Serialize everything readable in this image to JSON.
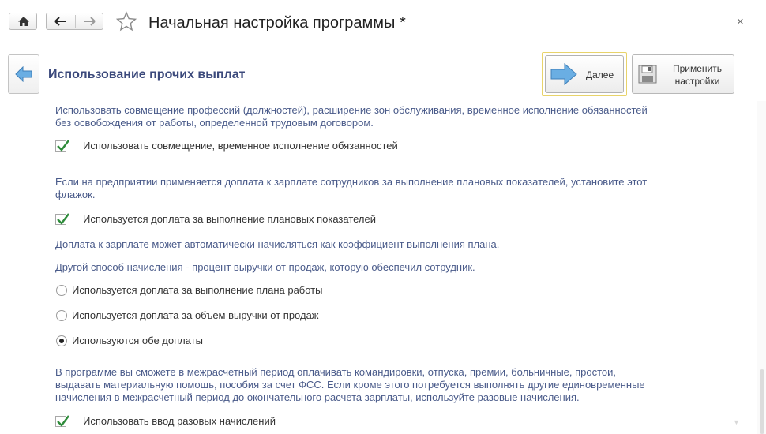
{
  "window": {
    "title": "Начальная настройка программы *",
    "close_glyph": "×"
  },
  "header": {
    "title": "Использование прочих выплат",
    "next_label": "Далее",
    "apply_label_line1": "Применить",
    "apply_label_line2": "настройки"
  },
  "sections": {
    "combination_desc_1": "Использовать совмещение профессий (должностей), расширение зон обслуживания, временное исполнение обязанностей",
    "combination_desc_2": "без освобождения от работы, определенной трудовым договором.",
    "combination_checkbox": "Использовать совмещение, временное исполнение обязанностей",
    "plan_desc_1": "Если на предприятии применяется доплата к зарплате сотрудников за выполнение плановых показателей, установите этот",
    "plan_desc_2": "флажок.",
    "plan_checkbox": "Используется доплата за выполнение плановых показателей",
    "auto_desc": "Доплата к зарплате может автоматически начисляться как коэффициент выполнения плана.",
    "other_desc": "Другой способ начисления - процент выручки от продаж, которую обеспечил сотрудник.",
    "radio_options": [
      "Используется доплата за выполнение плана работы",
      "Используется доплата за объем выручки от продаж",
      "Используются обе доплаты"
    ],
    "radio_selected": 2,
    "onetime_desc_1": "В программе вы сможете в межрасчетный период оплачивать командировки, отпуска, премии, больничные, простои,",
    "onetime_desc_2": "выдавать материальную помощь, пособия за счет ФСС. Если кроме этого потребуется выполнять другие единовременные",
    "onetime_desc_3": "начисления в межрасчетный период до окончательного расчета зарплаты, используйте разовые начисления.",
    "onetime_checkbox": "Использовать ввод разовых начислений"
  },
  "state": {
    "combination_checked": true,
    "plan_checked": true,
    "onetime_checked": true
  },
  "icons": {
    "home": "home-icon",
    "back": "arrow-left-icon",
    "forward": "arrow-right-icon",
    "favorite": "star-icon",
    "close": "close-icon",
    "step_back": "blue-arrow-left-icon",
    "next": "blue-arrow-right-icon",
    "save": "floppy-disk-icon",
    "check": "checkmark-icon"
  },
  "colors": {
    "accent_text": "#3c4a7c",
    "description_text": "#4a5b8a",
    "check_green": "#2e8b3a",
    "arrow_blue": "#5a9fd8",
    "highlight_border": "#e8d36a"
  }
}
